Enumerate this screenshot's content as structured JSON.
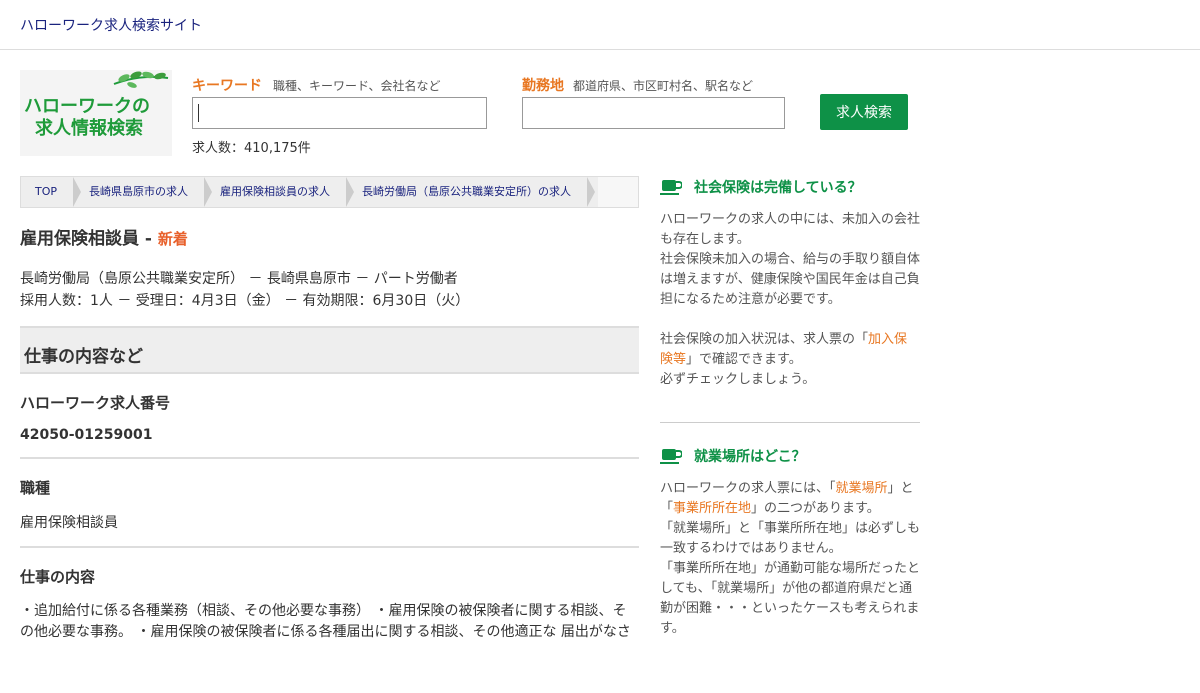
{
  "header": {
    "site_title": "ハローワーク求人検索サイト"
  },
  "logo": {
    "line1": "ハローワークの",
    "line2": "求人情報検索"
  },
  "search": {
    "keyword_label": "キーワード",
    "keyword_hint": "職種、キーワード、会社名など",
    "keyword_value": "",
    "location_label": "勤務地",
    "location_hint": "都道府県、市区町村名、駅名など",
    "location_value": "",
    "count_text": "求人数：410,175件",
    "button_label": "求人検索"
  },
  "breadcrumb": [
    "TOP",
    "長崎県島原市の求人",
    "雇用保険相談員の求人",
    "長崎労働局（島原公共職業安定所）の求人"
  ],
  "job": {
    "title": "雇用保険相談員",
    "separator": " - ",
    "badge": "新着",
    "meta_line1": "長崎労働局（島原公共職業安定所） － 長崎県島原市 － パート労働者",
    "meta_line2": "採用人数：1人 － 受理日：4月3日（金） － 有効期限：6月30日（火）"
  },
  "section": {
    "title": "仕事の内容など"
  },
  "items": {
    "number_label": "ハローワーク求人番号",
    "number_value": "42050-01259001",
    "type_label": "職種",
    "type_value": "雇用保険相談員",
    "content_label": "仕事の内容",
    "content_value": "・追加給付に係る各種業務（相談、その他必要な事務） ・雇用保険の被保険者に関する相談、その他必要な事務。 ・雇用保険の被保険者に係る各種届出に関する相談、その他適正な 届出がなさ"
  },
  "sidebar": {
    "block1": {
      "title": "社会保険は完備している？",
      "p1": "ハローワークの求人の中には、未加入の会社も存在します。",
      "p2": "社会保険未加入の場合、給与の手取り額自体は増えますが、健康保険や国民年金は自己負担になるため注意が必要です。",
      "p3_before": "社会保険の加入状況は、求人票の「",
      "p3_link": "加入保険等",
      "p3_after": "」で確認できます。",
      "p4": "必ずチェックしましょう。"
    },
    "block2": {
      "title": "就業場所はどこ？",
      "t1": "ハローワークの求人票には、「",
      "link1": "就業場所",
      "t2": "」と「",
      "link2": "事業所所在地",
      "t3": "」の二つがあります。",
      "p2": "「就業場所」と「事業所所在地」は必ずしも一致するわけではありません。",
      "p3": "「事業所所在地」が通勤可能な場所だったとしても、「就業場所」が他の都道府県だと通勤が困難・・・といったケースも考えられます。"
    }
  },
  "colors": {
    "accent_green": "#0e9147",
    "accent_orange": "#e87722",
    "badge_red": "#e8612c",
    "link_navy": "#1a237e"
  },
  "icons": {
    "side_icon": "cup-icon",
    "logo_decoration": "leaves-icon"
  }
}
